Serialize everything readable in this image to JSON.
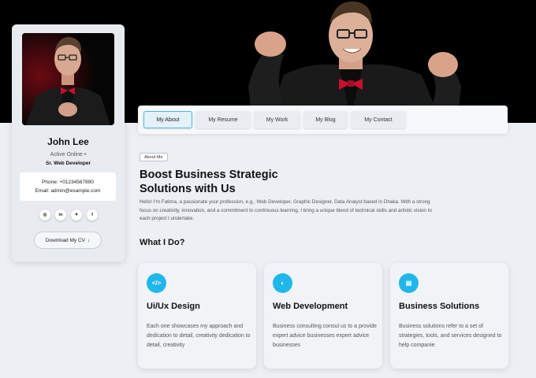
{
  "profile": {
    "name": "John Lee",
    "status": "Active Online •",
    "role": "Sr. Web Developer",
    "phone": "Phone: +01234567890",
    "email": "Email: admin@example.com",
    "socials": [
      {
        "icon": "instagram-icon",
        "glyph": "◎"
      },
      {
        "icon": "linkedin-icon",
        "glyph": "in"
      },
      {
        "icon": "twitter-icon",
        "glyph": "✦"
      },
      {
        "icon": "facebook-icon",
        "glyph": "f"
      }
    ],
    "cv_button": "Download My CV",
    "cv_arrow": "↓"
  },
  "nav": {
    "tabs": [
      "My About",
      "My Resume",
      "My Work",
      "My Blog",
      "My Contact"
    ],
    "active_index": 0
  },
  "about": {
    "badge": "About Me",
    "headline_line1": "Boost Business Strategic",
    "headline_line2": "Solutions with Us",
    "intro": "Hello! I'm Fatima, a passionate your profession, e.g., Web Developer, Graphic Designer, Data Analyst based in Dhaka. With a strong focus on creativity, innovation, and a commitment to continuous learning, I bring a unique blend of technical skills and artistic vision to each project I undertake."
  },
  "services_section": {
    "title": "What I Do?",
    "items": [
      {
        "icon": "code-icon",
        "glyph": "</>",
        "title": "Ui/Ux Design",
        "desc": "Each one showcases my approach and dedication to detail, creativity dedication to detail, creativity"
      },
      {
        "icon": "palette-icon",
        "glyph": "◐",
        "title": "Web Development",
        "desc": "Business consulting consul us to a provide expert advice businesses expert advice businesses"
      },
      {
        "icon": "briefcase-icon",
        "glyph": "▤",
        "title": "Business Solutions",
        "desc": "Business solutions refer to a set of strategies, tools, and services designed to help companie."
      }
    ]
  },
  "colors": {
    "accent": "#1fb7ea",
    "background": "#eceff3",
    "hero": "#000000",
    "tie": "#c8102e"
  }
}
